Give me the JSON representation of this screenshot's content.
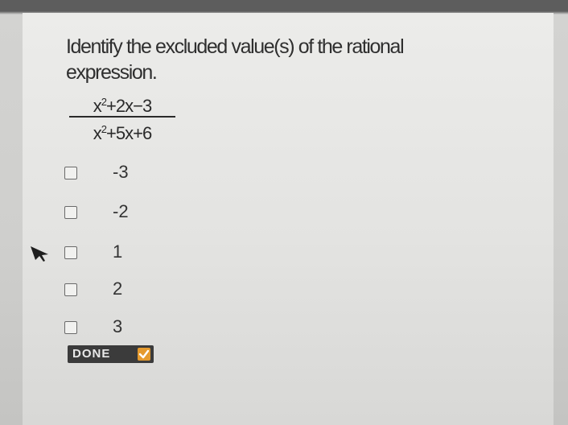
{
  "question": {
    "line1": "Identify the excluded value(s) of the rational",
    "line2": "expression."
  },
  "expression": {
    "numerator_a": "x",
    "numerator_exp": "2",
    "numerator_b": "+2x−3",
    "denominator_a": "x",
    "denominator_exp": "2",
    "denominator_b": "+5x+6"
  },
  "choices": [
    {
      "label": "-3",
      "checked": false
    },
    {
      "label": "-2",
      "checked": false
    },
    {
      "label": "1",
      "checked": false
    },
    {
      "label": "2",
      "checked": false
    },
    {
      "label": "3",
      "checked": false
    }
  ],
  "done_button": {
    "label": "DONE",
    "check_icon": "checkmark-icon"
  },
  "colors": {
    "panel_bg": "#e9e9e7",
    "text": "#2f2f2f",
    "done_bg": "#3b3b3b",
    "done_accent": "#e59a2e"
  }
}
